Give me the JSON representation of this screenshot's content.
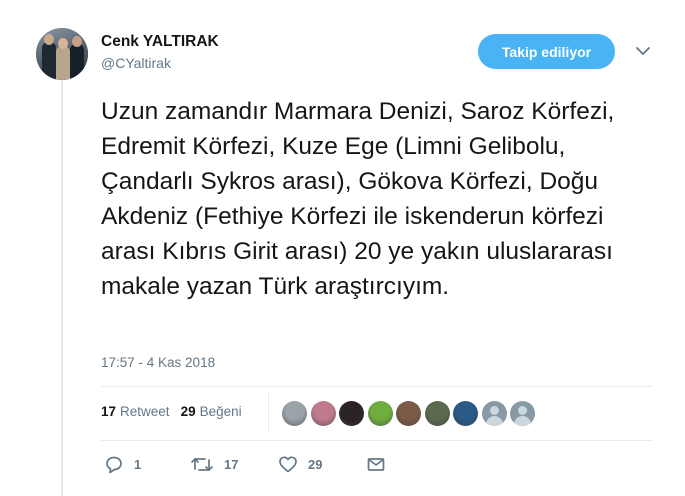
{
  "user": {
    "name": "Cenk YALTIRAK",
    "handle": "@CYaltirak"
  },
  "follow_button": {
    "label": "Takip ediliyor",
    "color": "#4ab3f4"
  },
  "tweet": {
    "text": "Uzun zamandır Marmara Denizi,  Saroz Körfezi, Edremit Körfezi, Kuze Ege (Limni Gelibolu,  Çandarlı Sykros arası), Gökova Körfezi,  Doğu Akdeniz (Fethiye Körfezi ile iskenderun körfezi arası Kıbrıs Girit arası) 20 ye yakın uluslararası makale yazan Türk araştırcıyım.",
    "timestamp": "17:57 - 4 Kas 2018"
  },
  "stats": {
    "retweets_count": "17",
    "retweets_label": "Retweet",
    "likes_count": "29",
    "likes_label": "Beğeni"
  },
  "likers": [
    {
      "name": "liker-1",
      "color": "#9aa3a8"
    },
    {
      "name": "liker-2",
      "color": "#c07a8e"
    },
    {
      "name": "liker-3",
      "color": "#2b2224"
    },
    {
      "name": "liker-4",
      "color": "#6fae3e"
    },
    {
      "name": "liker-5",
      "color": "#7b5b48"
    },
    {
      "name": "liker-6",
      "color": "#5b6a4d"
    },
    {
      "name": "liker-7",
      "color": "#2a5a86"
    },
    {
      "name": "liker-8",
      "color": "#c0c8cf"
    },
    {
      "name": "liker-9",
      "color": "#c0c8cf"
    }
  ],
  "actions": {
    "reply_count": "1",
    "retweet_count": "17",
    "like_count": "29"
  },
  "icons": {
    "caret": "chevron-down-icon",
    "reply": "reply-icon",
    "retweet": "retweet-icon",
    "like": "heart-icon",
    "dm": "envelope-icon"
  }
}
